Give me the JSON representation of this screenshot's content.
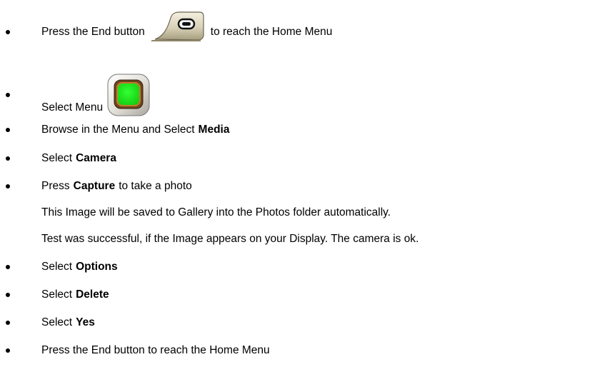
{
  "colors": {
    "text": "#000000",
    "menu_key_center": "#22ee22",
    "menu_key_ring": "#c07a2a",
    "key_metal": "#d8d2bc"
  },
  "items": [
    {
      "pre": "Press the End button",
      "icon": "end-key-icon",
      "post": "to reach the Home Menu"
    },
    {
      "pre": "Select Menu",
      "icon": "menu-key-icon"
    },
    {
      "pre": "Browse in the Menu and Select",
      "bold": "Media"
    },
    {
      "pre": "Select",
      "bold": "Camera"
    },
    {
      "pre": "Press",
      "bold": "Capture",
      "post": "to take a photo"
    },
    {
      "note": "This Image will be saved to Gallery into the Photos folder automatically."
    },
    {
      "note": "Test was successful, if the Image appears on your Display. The camera is ok."
    },
    {
      "pre": "Select",
      "bold": "Options"
    },
    {
      "pre": "Select",
      "bold": "Delete"
    },
    {
      "pre": "Select",
      "bold": "Yes"
    },
    {
      "pre": "Press the End button to reach the Home Menu"
    }
  ]
}
